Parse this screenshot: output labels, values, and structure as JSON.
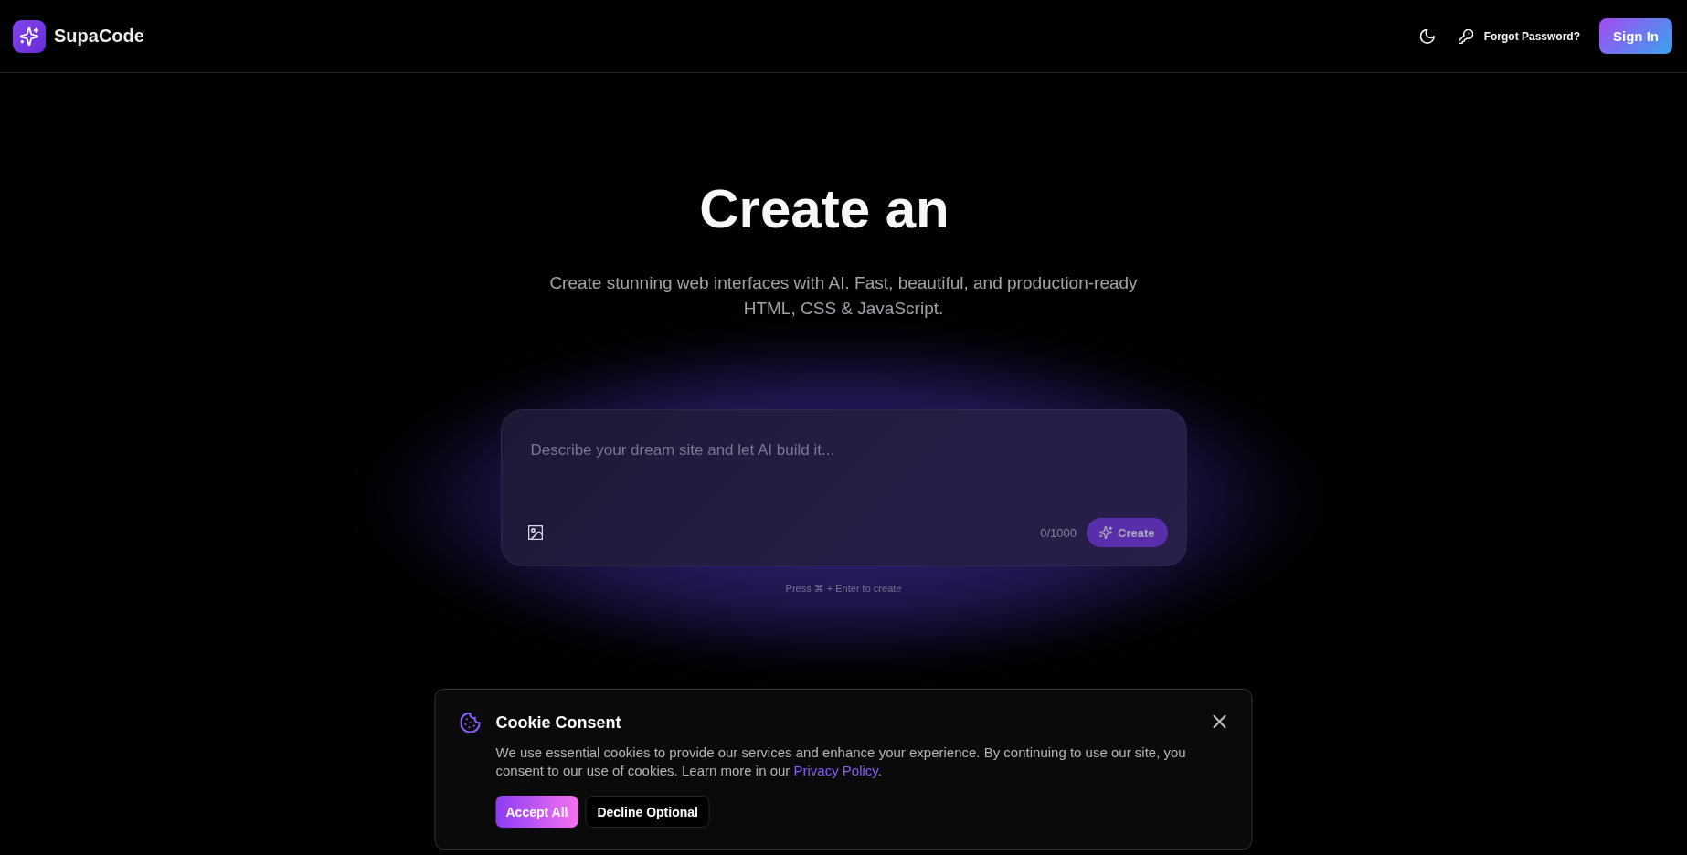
{
  "header": {
    "brand": "SupaCode",
    "forgot_password": "Forgot Password?",
    "sign_in": "Sign In"
  },
  "hero": {
    "title": "Create an",
    "subtitle": "Create stunning web interfaces with AI. Fast, beautiful, and production-ready HTML, CSS & JavaScript."
  },
  "prompt": {
    "placeholder": "Describe your dream site and let AI build it...",
    "counter": "0/1000",
    "submit": {
      "label": "Create",
      "disabled": true
    },
    "hint": "Press ⌘ + Enter to create"
  },
  "cookie_banner": {
    "title": "Cookie Consent",
    "message": "We use essential cookies to provide our services and enhance your experience. By continuing to use our site, you consent to our use of cookies. Learn more in our",
    "link": "Privacy Policy",
    "message_end": ".",
    "buttons": [
      {
        "label": "Accept All",
        "kind": "primary"
      },
      {
        "label": "Decline Optional",
        "kind": "secondary"
      }
    ]
  }
}
